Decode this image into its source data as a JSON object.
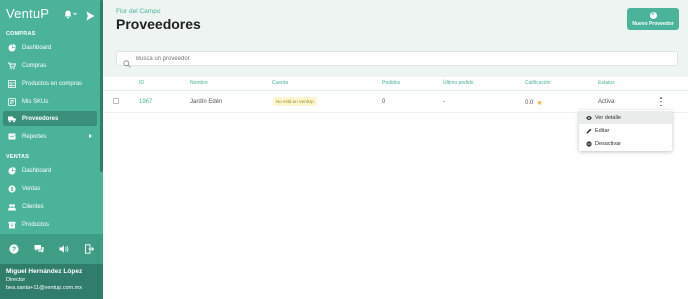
{
  "app": {
    "logo": "VentuP"
  },
  "sidebar": {
    "compras_title": "COMPRAS",
    "compras_items": [
      {
        "label": "Dashboard",
        "icon": "pie-chart-icon"
      },
      {
        "label": "Compras",
        "icon": "cart-icon"
      },
      {
        "label": "Productos en compras",
        "icon": "grid-icon"
      },
      {
        "label": "Mis SKUs",
        "icon": "tag-icon"
      },
      {
        "label": "Proveedores",
        "icon": "truck-icon",
        "active": true
      },
      {
        "label": "Reportes",
        "icon": "chart-icon"
      }
    ],
    "ventas_title": "VENTAS",
    "ventas_items": [
      {
        "label": "Dashboard",
        "icon": "pie-chart-icon"
      },
      {
        "label": "Ventas",
        "icon": "dollar-icon"
      },
      {
        "label": "Clientes",
        "icon": "users-icon"
      },
      {
        "label": "Productos",
        "icon": "box-icon"
      }
    ]
  },
  "user": {
    "name": "Miguel Hernández López",
    "role": "Director",
    "email": "bea.santa+11@ventup.com.mx"
  },
  "header": {
    "breadcrumb": "Flor del Campo",
    "title": "Proveedores",
    "new_button_label": "Nuevo Proveedor"
  },
  "search": {
    "placeholder": "Busca un proveedor"
  },
  "table": {
    "columns": [
      "ID",
      "Nombre",
      "Cuenta",
      "Pedidos",
      "Último pedido",
      "Calificación",
      "Estatus"
    ],
    "rows": [
      {
        "id": "1967",
        "nombre": "Jardín Edén",
        "cuenta": "No está en VentUp",
        "pedidos": "0",
        "ultimo": "-",
        "calificacion": "0.0",
        "estatus": "Activa"
      }
    ]
  },
  "menu": {
    "items": [
      "Ver detalle",
      "Editar",
      "Desactivar"
    ]
  },
  "colors": {
    "primary": "#4bb39a",
    "dark": "#2f7d6a",
    "badge_bg": "#fdf6cf",
    "star": "#f2b33d"
  }
}
